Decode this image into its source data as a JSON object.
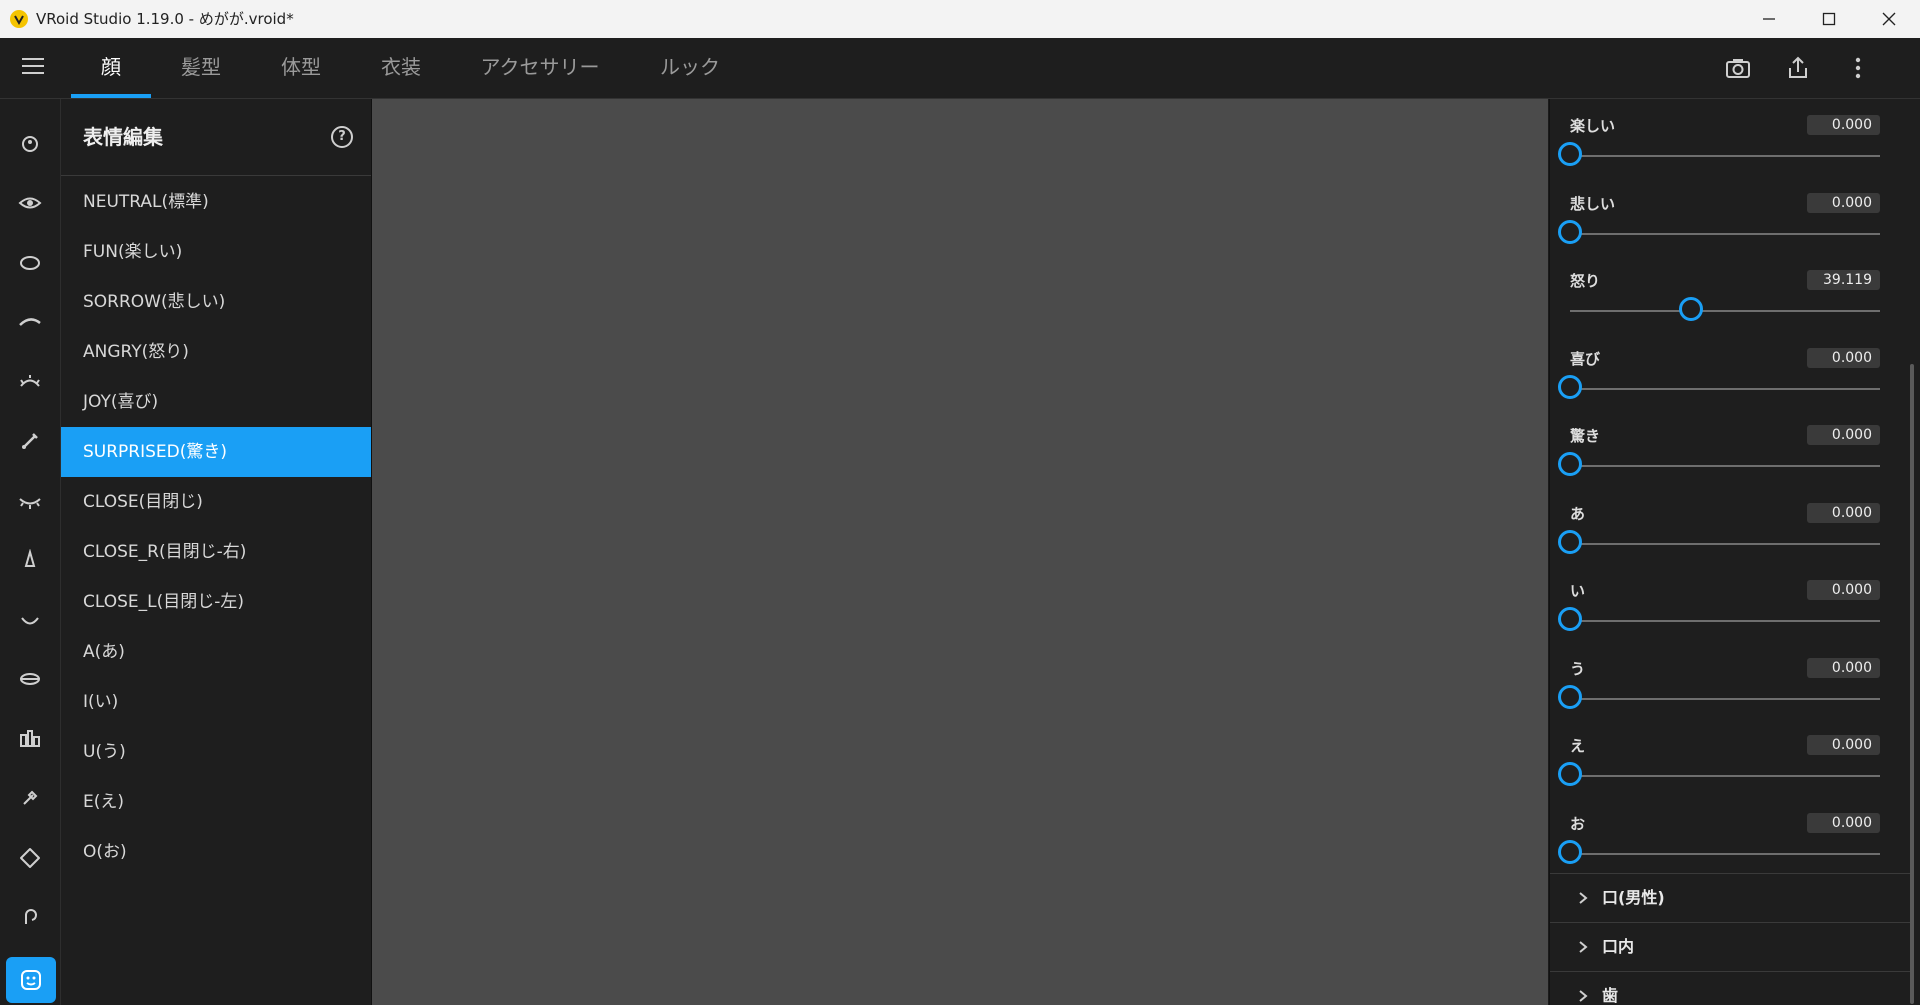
{
  "window": {
    "title": "VRoid Studio 1.19.0 - めがが.vroid*"
  },
  "nav": {
    "tabs": [
      {
        "label": "顔",
        "active": true
      },
      {
        "label": "髪型",
        "active": false
      },
      {
        "label": "体型",
        "active": false
      },
      {
        "label": "衣装",
        "active": false
      },
      {
        "label": "アクセサリー",
        "active": false
      },
      {
        "label": "ルック",
        "active": false
      }
    ],
    "right_icons": [
      "camera-icon",
      "export-icon",
      "more-vertical-icon"
    ]
  },
  "rail": {
    "icons": [
      "face-outline-icon",
      "eye-icon",
      "eye-shape-icon",
      "eyebrow-icon",
      "eyelash-icon",
      "eyeliner-icon",
      "closed-eye-icon",
      "nose-icon",
      "mouth-icon",
      "lips-icon",
      "teeth-icon",
      "brush-icon",
      "head-shape-icon",
      "ear-icon",
      "expression-icon"
    ],
    "active_index": 14
  },
  "expressions": {
    "title": "表情編集",
    "items": [
      "NEUTRAL(標準)",
      "FUN(楽しい)",
      "SORROW(悲しい)",
      "ANGRY(怒り)",
      "JOY(喜び)",
      "SURPRISED(驚き)",
      "CLOSE(目閉じ)",
      "CLOSE_R(目閉じ-右)",
      "CLOSE_L(目閉じ-左)",
      "A(あ)",
      "I(い)",
      "U(う)",
      "E(え)",
      "O(お)"
    ],
    "selected": "SURPRISED(驚き)"
  },
  "sliders": [
    {
      "label": "楽しい",
      "value": "0.000",
      "fraction": 0
    },
    {
      "label": "悲しい",
      "value": "0.000",
      "fraction": 0
    },
    {
      "label": "怒り",
      "value": "39.119",
      "fraction": 0.391
    },
    {
      "label": "喜び",
      "value": "0.000",
      "fraction": 0
    },
    {
      "label": "驚き",
      "value": "0.000",
      "fraction": 0
    },
    {
      "label": "あ",
      "value": "0.000",
      "fraction": 0
    },
    {
      "label": "い",
      "value": "0.000",
      "fraction": 0
    },
    {
      "label": "う",
      "value": "0.000",
      "fraction": 0
    },
    {
      "label": "え",
      "value": "0.000",
      "fraction": 0
    },
    {
      "label": "お",
      "value": "0.000",
      "fraction": 0
    }
  ],
  "sections": [
    "口(男性)",
    "口内",
    "歯"
  ],
  "colors": {
    "accent": "#1a9ff5",
    "viewport_bg": "#4b4b4b"
  }
}
